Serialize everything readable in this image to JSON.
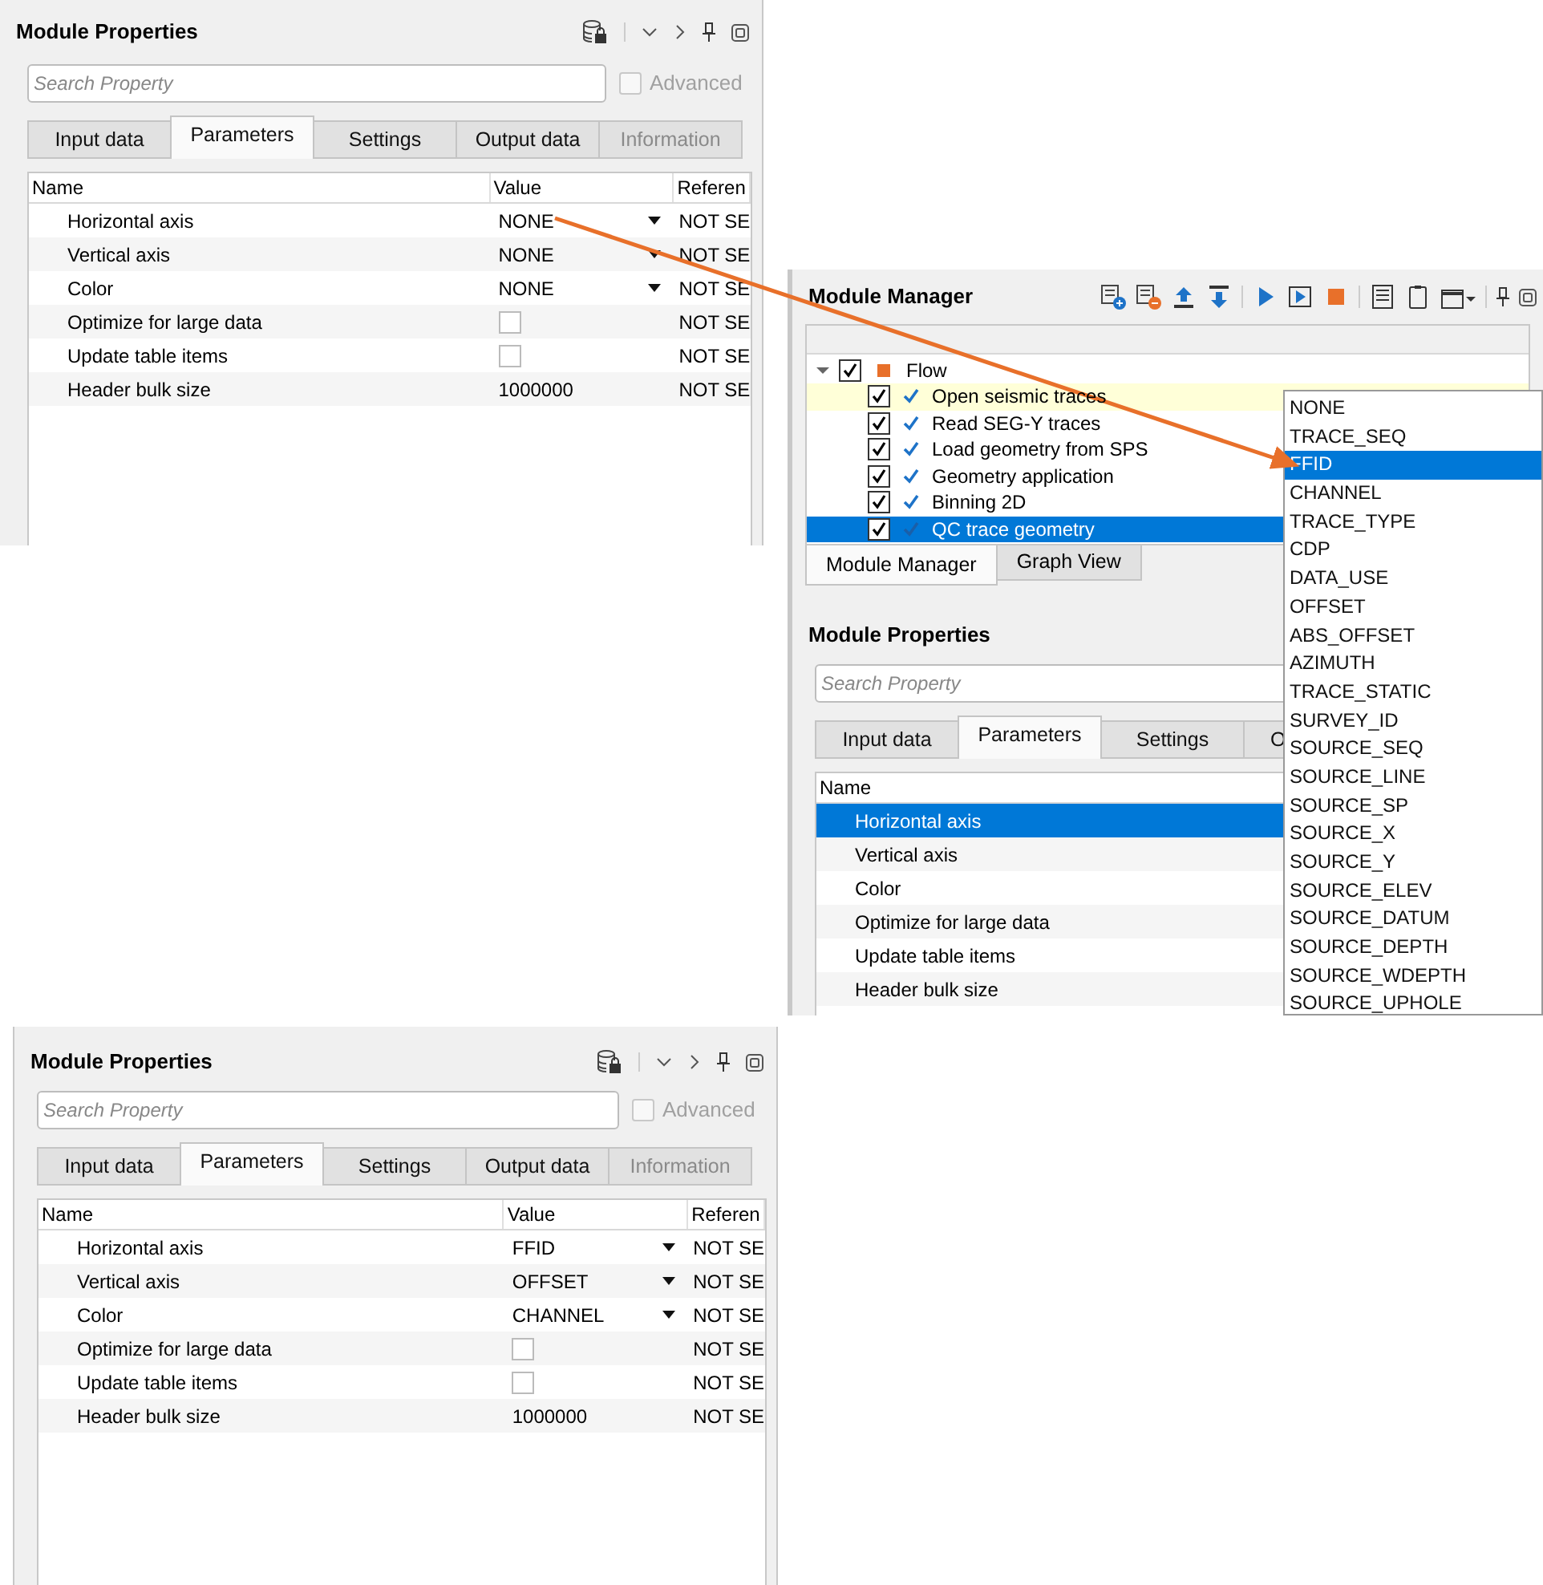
{
  "top_properties": {
    "title": "Module Properties",
    "search": {
      "placeholder": "Search Property"
    },
    "advanced": {
      "label": "Advanced",
      "checked": false
    },
    "tabs": [
      {
        "label": "Input data",
        "selected": false,
        "disabled": false
      },
      {
        "label": "Parameters",
        "selected": true,
        "disabled": false
      },
      {
        "label": "Settings",
        "selected": false,
        "disabled": false
      },
      {
        "label": "Output data",
        "selected": false,
        "disabled": false
      },
      {
        "label": "Information",
        "selected": false,
        "disabled": true
      }
    ],
    "columns": [
      "Name",
      "Value",
      "Referen"
    ],
    "rows": [
      {
        "name": "Horizontal axis",
        "kind": "dropdown",
        "value": "NONE",
        "reference": "NOT SE",
        "selected": false
      },
      {
        "name": "Vertical axis",
        "kind": "dropdown",
        "value": "NONE",
        "reference": "NOT SE",
        "selected": false
      },
      {
        "name": "Color",
        "kind": "dropdown",
        "value": "NONE",
        "reference": "NOT SE",
        "selected": false
      },
      {
        "name": "Optimize for large data",
        "kind": "checkbox",
        "checked": false,
        "reference": "NOT SE",
        "selected": false
      },
      {
        "name": "Update table items",
        "kind": "checkbox",
        "checked": false,
        "reference": "NOT SE",
        "selected": false
      },
      {
        "name": "Header bulk size",
        "kind": "text",
        "value": "1000000",
        "reference": "NOT SE",
        "selected": false
      }
    ]
  },
  "module_manager": {
    "title": "Module Manager",
    "tree": {
      "label": "Flow",
      "checked": true,
      "expanded": true,
      "children": [
        {
          "label": "Open seismic traces",
          "checked": true,
          "highlighted": true,
          "selected": false
        },
        {
          "label": "Read SEG-Y traces",
          "checked": true,
          "highlighted": false,
          "selected": false
        },
        {
          "label": "Load geometry from SPS",
          "checked": true,
          "highlighted": false,
          "selected": false
        },
        {
          "label": "Geometry application",
          "checked": true,
          "highlighted": false,
          "selected": false
        },
        {
          "label": "Binning 2D",
          "checked": true,
          "highlighted": false,
          "selected": false
        },
        {
          "label": "QC trace geometry",
          "checked": true,
          "highlighted": false,
          "selected": true
        }
      ]
    },
    "tabs": [
      {
        "label": "Module Manager",
        "selected": true
      },
      {
        "label": "Graph View",
        "selected": false
      }
    ]
  },
  "middle_properties": {
    "title": "Module Properties",
    "search": {
      "placeholder": "Search Property"
    },
    "tabs": [
      {
        "label": "Input data",
        "selected": false,
        "disabled": false
      },
      {
        "label": "Parameters",
        "selected": true,
        "disabled": false
      },
      {
        "label": "Settings",
        "selected": false,
        "disabled": false
      },
      {
        "label": "O",
        "selected": false,
        "disabled": false
      }
    ],
    "columns": [
      "Name"
    ],
    "rows": [
      {
        "name": "Horizontal axis",
        "selected": true
      },
      {
        "name": "Vertical axis",
        "selected": false
      },
      {
        "name": "Color",
        "selected": false
      },
      {
        "name": "Optimize for large data",
        "selected": false
      },
      {
        "name": "Update table items",
        "selected": false
      },
      {
        "name": "Header bulk size",
        "selected": false
      }
    ]
  },
  "dropdown": {
    "items": [
      {
        "label": "NONE",
        "selected": false
      },
      {
        "label": "TRACE_SEQ",
        "selected": false
      },
      {
        "label": "FFID",
        "selected": true
      },
      {
        "label": "CHANNEL",
        "selected": false
      },
      {
        "label": "TRACE_TYPE",
        "selected": false
      },
      {
        "label": "CDP",
        "selected": false
      },
      {
        "label": "DATA_USE",
        "selected": false
      },
      {
        "label": "OFFSET",
        "selected": false
      },
      {
        "label": "ABS_OFFSET",
        "selected": false
      },
      {
        "label": "AZIMUTH",
        "selected": false
      },
      {
        "label": "TRACE_STATIC",
        "selected": false
      },
      {
        "label": "SURVEY_ID",
        "selected": false
      },
      {
        "label": "SOURCE_SEQ",
        "selected": false
      },
      {
        "label": "SOURCE_LINE",
        "selected": false
      },
      {
        "label": "SOURCE_SP",
        "selected": false
      },
      {
        "label": "SOURCE_X",
        "selected": false
      },
      {
        "label": "SOURCE_Y",
        "selected": false
      },
      {
        "label": "SOURCE_ELEV",
        "selected": false
      },
      {
        "label": "SOURCE_DATUM",
        "selected": false
      },
      {
        "label": "SOURCE_DEPTH",
        "selected": false
      },
      {
        "label": "SOURCE_WDEPTH",
        "selected": false
      },
      {
        "label": "SOURCE_UPHOLE",
        "selected": false
      }
    ]
  },
  "bottom_properties": {
    "title": "Module Properties",
    "search": {
      "placeholder": "Search Property"
    },
    "advanced": {
      "label": "Advanced",
      "checked": false
    },
    "tabs": [
      {
        "label": "Input data",
        "selected": false,
        "disabled": false
      },
      {
        "label": "Parameters",
        "selected": true,
        "disabled": false
      },
      {
        "label": "Settings",
        "selected": false,
        "disabled": false
      },
      {
        "label": "Output data",
        "selected": false,
        "disabled": false
      },
      {
        "label": "Information",
        "selected": false,
        "disabled": true
      }
    ],
    "columns": [
      "Name",
      "Value",
      "Referen"
    ],
    "rows": [
      {
        "name": "Horizontal axis",
        "kind": "dropdown",
        "value": "FFID",
        "reference": "NOT SE",
        "selected": false
      },
      {
        "name": "Vertical axis",
        "kind": "dropdown",
        "value": "OFFSET",
        "reference": "NOT SE",
        "selected": false
      },
      {
        "name": "Color",
        "kind": "dropdown",
        "value": "CHANNEL",
        "reference": "NOT SE",
        "selected": false
      },
      {
        "name": "Optimize for large data",
        "kind": "checkbox",
        "checked": false,
        "reference": "NOT SE",
        "selected": false
      },
      {
        "name": "Update table items",
        "kind": "checkbox",
        "checked": false,
        "reference": "NOT SE",
        "selected": false
      },
      {
        "name": "Header bulk size",
        "kind": "text",
        "value": "1000000",
        "reference": "NOT SE",
        "selected": false
      }
    ]
  }
}
